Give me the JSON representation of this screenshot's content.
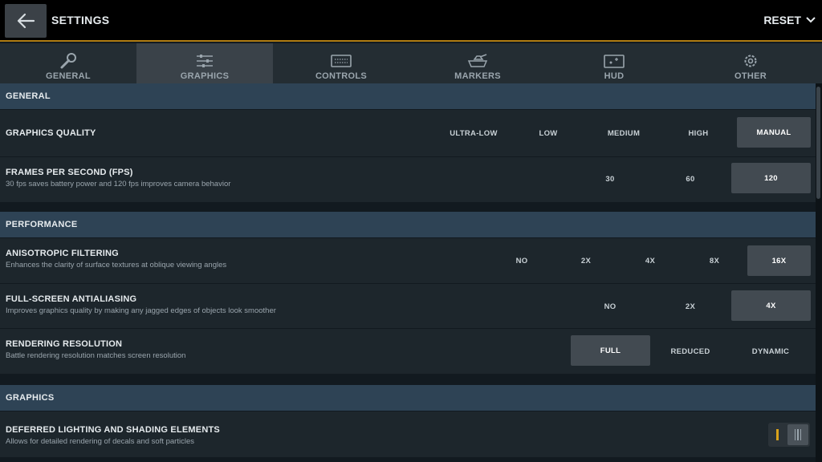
{
  "header": {
    "title": "SETTINGS",
    "reset_label": "RESET"
  },
  "tabs": [
    {
      "label": "GENERAL",
      "icon": "wrench-icon"
    },
    {
      "label": "GRAPHICS",
      "icon": "sliders-icon"
    },
    {
      "label": "CONTROLS",
      "icon": "keyboard-icon"
    },
    {
      "label": "MARKERS",
      "icon": "tank-icon"
    },
    {
      "label": "HUD",
      "icon": "hud-icon"
    },
    {
      "label": "OTHER",
      "icon": "gear-icon"
    }
  ],
  "active_tab": "GRAPHICS",
  "accent_color": "#d9a21a",
  "sections": {
    "general": "GENERAL",
    "performance": "PERFORMANCE",
    "graphics": "GRAPHICS"
  },
  "settings": {
    "graphics_quality": {
      "title": "GRAPHICS QUALITY",
      "options": [
        "ULTRA-LOW",
        "LOW",
        "MEDIUM",
        "HIGH",
        "MANUAL"
      ],
      "selected": "MANUAL"
    },
    "fps": {
      "title": "FRAMES PER SECOND (FPS)",
      "description": "30 fps saves battery power and 120 fps improves camera behavior",
      "options": [
        "30",
        "60",
        "120"
      ],
      "selected": "120"
    },
    "aniso": {
      "title": "ANISOTROPIC FILTERING",
      "description": "Enhances the clarity of surface textures at oblique viewing angles",
      "options": [
        "NO",
        "2X",
        "4X",
        "8X",
        "16X"
      ],
      "selected": "16X"
    },
    "fsaa": {
      "title": "FULL-SCREEN ANTIALIASING",
      "description": "Improves graphics quality by making any jagged edges of objects look smoother",
      "options": [
        "NO",
        "2X",
        "4X"
      ],
      "selected": "4X"
    },
    "resolution": {
      "title": "RENDERING RESOLUTION",
      "description": "Battle rendering resolution matches screen resolution",
      "options": [
        "FULL",
        "REDUCED",
        "DYNAMIC"
      ],
      "selected": "FULL"
    },
    "deferred": {
      "title": "DEFERRED LIGHTING AND SHADING ELEMENTS",
      "description": "Allows for detailed rendering of decals and soft particles",
      "enabled": true
    }
  }
}
